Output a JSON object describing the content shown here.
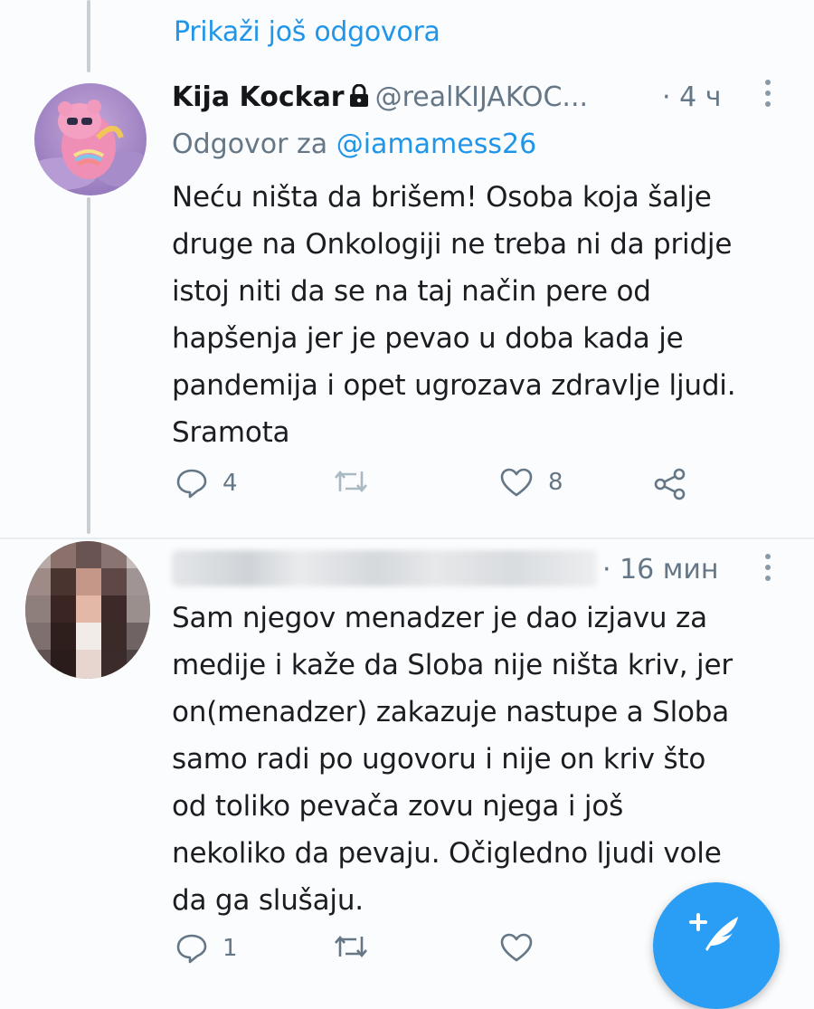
{
  "thread": {
    "show_more_label": "Prikaži još odgovora"
  },
  "tweets": [
    {
      "display_name": "Kija Kockar",
      "handle": "@realKIJAKOC...",
      "time": "· 4 ч",
      "locked": true,
      "reply_prefix": "Odgovor za",
      "reply_to": "@iamamess26",
      "lines": [
        "Neću ništa da brišem! Osoba koja šalje",
        "druge na Onkologiji ne treba ni da pridje",
        "istoj niti da se na taj način pere od",
        "hapšenja jer je pevao u doba kada je",
        "pandemija i opet ugrozava zdravlje ljudi.",
        "Sramota"
      ],
      "reply_count": "4",
      "retweet_count": "",
      "like_count": "8"
    },
    {
      "display_name": "",
      "handle": "",
      "time": "· 16 мин",
      "locked": false,
      "lines": [
        "Sam njegov menadzer je dao izjavu za",
        "medije i kaže da Sloba nije ništa kriv, jer",
        "on(menadzer) zakazuje nastupe a Sloba",
        "samo radi po ugovoru i nije on kriv što",
        "od toliko pevača zovu njega i još",
        "nekoliko da pevaju. Očigledno ljudi vole",
        "da ga slušaju."
      ],
      "reply_count": "1",
      "retweet_count": "",
      "like_count": ""
    }
  ],
  "icons": {
    "more": "more-vertical-icon",
    "reply": "reply-bubble-icon",
    "retweet": "retweet-icon",
    "like": "heart-icon",
    "share": "share-icon",
    "lock": "lock-icon",
    "compose": "compose-tweet-icon"
  },
  "colors": {
    "accent": "#2196e9",
    "secondary_text": "#657786",
    "fab": "#2a9df4"
  }
}
